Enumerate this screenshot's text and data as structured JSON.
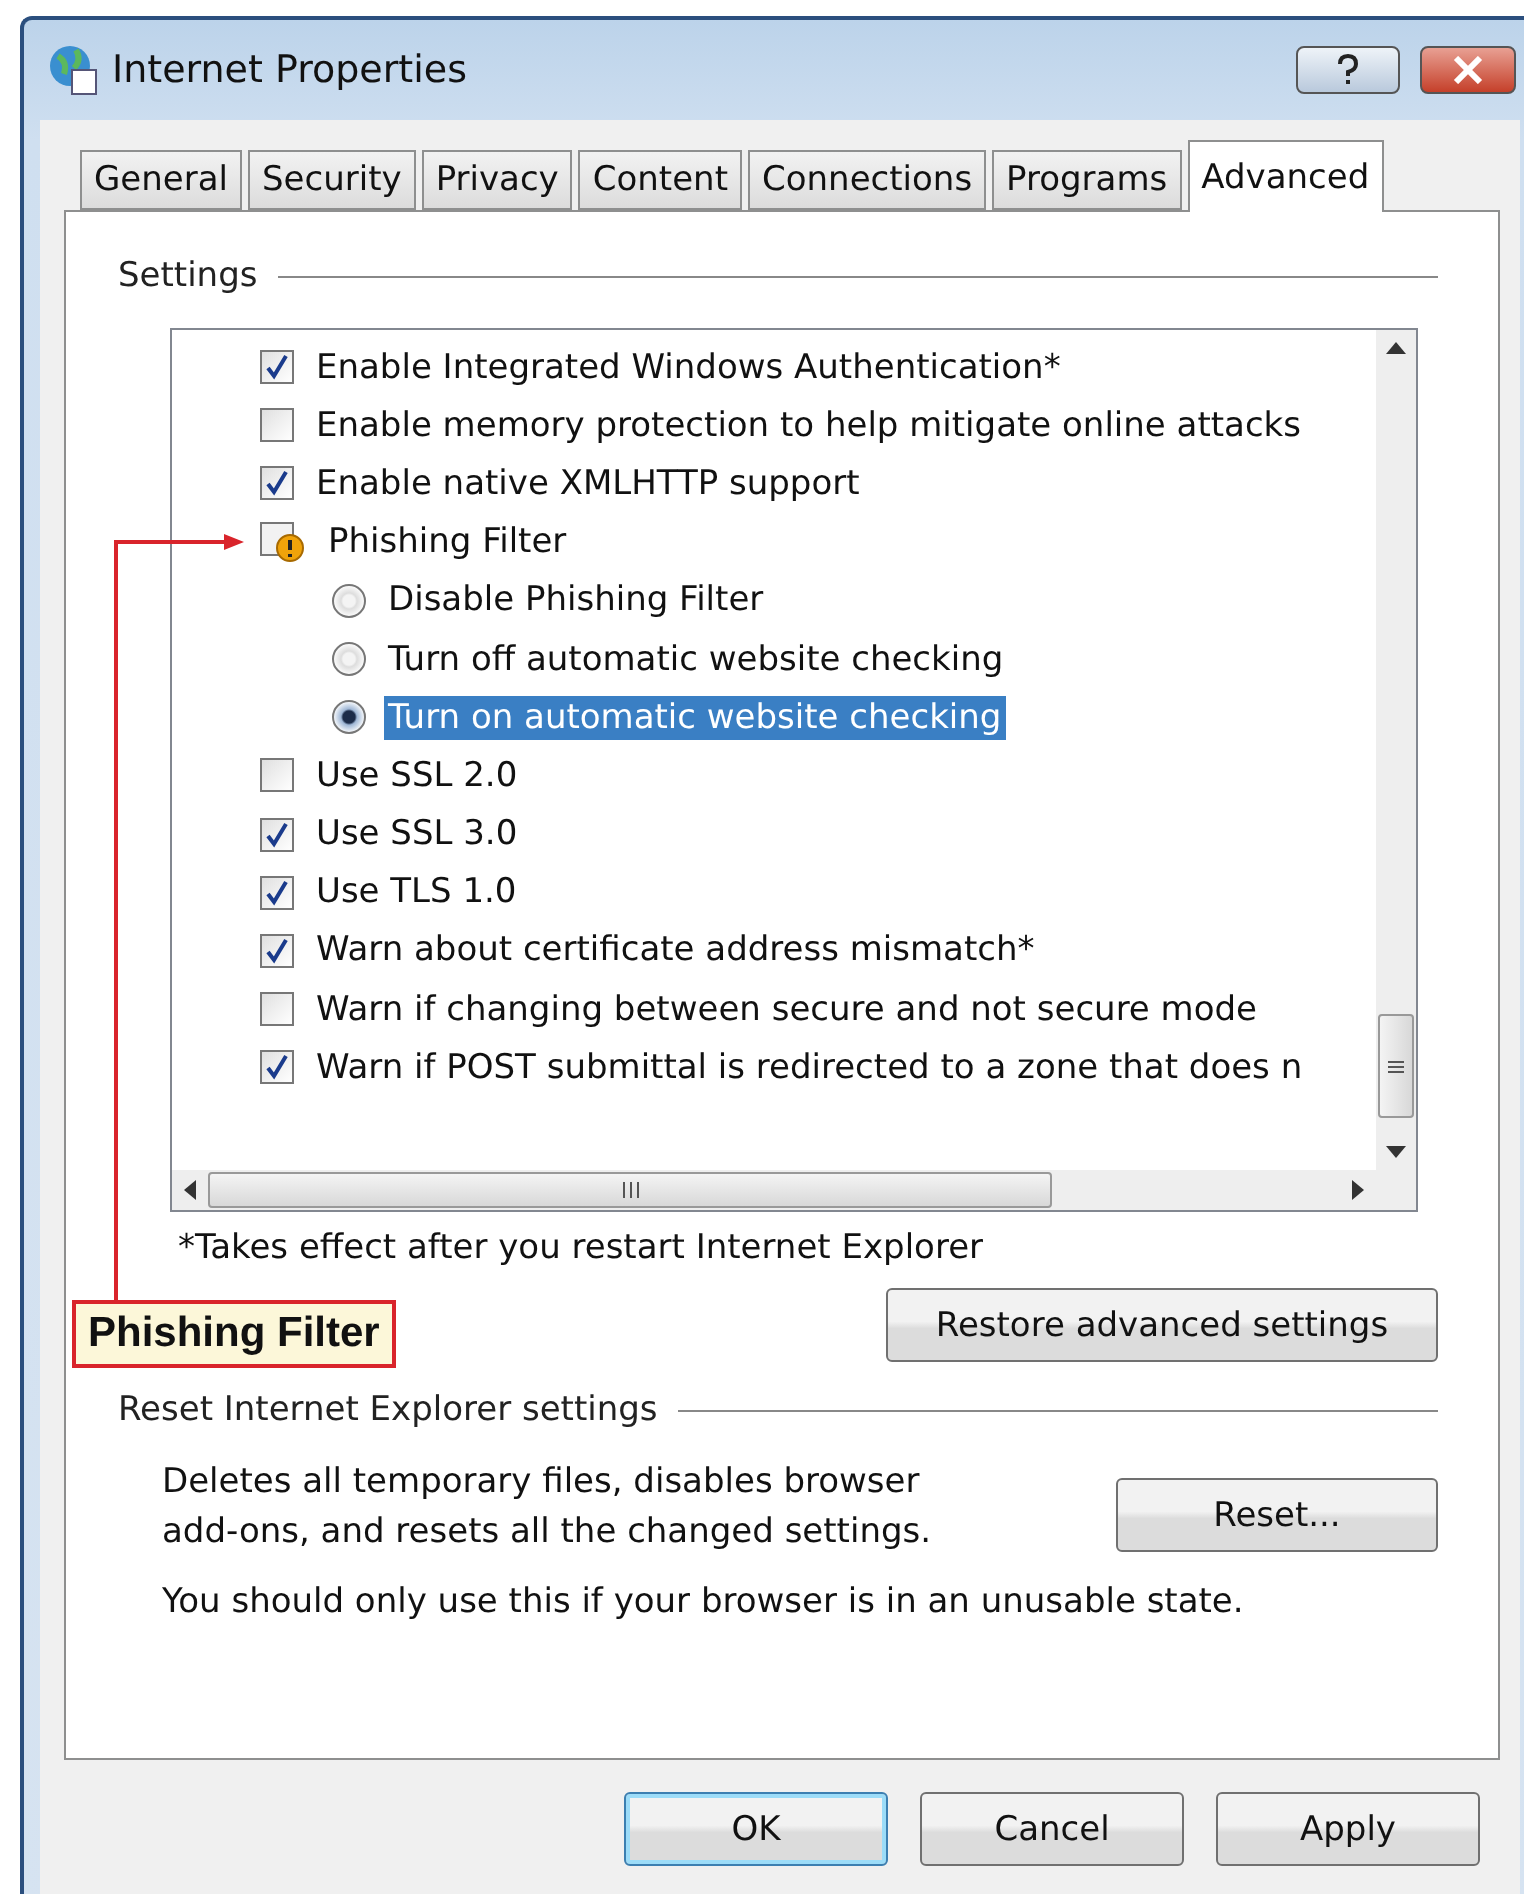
{
  "window": {
    "title": "Internet Properties"
  },
  "tabs": [
    {
      "label": "General",
      "selected": false
    },
    {
      "label": "Security",
      "selected": false
    },
    {
      "label": "Privacy",
      "selected": false
    },
    {
      "label": "Content",
      "selected": false
    },
    {
      "label": "Connections",
      "selected": false
    },
    {
      "label": "Programs",
      "selected": false
    },
    {
      "label": "Advanced",
      "selected": true
    }
  ],
  "settings": {
    "title": "Settings",
    "items": [
      {
        "kind": "checkbox",
        "label": "Enable Integrated Windows Authentication*",
        "checked": true
      },
      {
        "kind": "checkbox",
        "label": "Enable memory protection to help mitigate online attacks",
        "checked": false
      },
      {
        "kind": "checkbox",
        "label": "Enable native XMLHTTP support",
        "checked": true
      },
      {
        "kind": "group",
        "label": "Phishing Filter"
      },
      {
        "kind": "radio",
        "label": "Disable Phishing Filter",
        "selected": false
      },
      {
        "kind": "radio",
        "label": "Turn off automatic website checking",
        "selected": false
      },
      {
        "kind": "radio",
        "label": "Turn on automatic website checking",
        "selected": true
      },
      {
        "kind": "checkbox",
        "label": "Use SSL 2.0",
        "checked": false
      },
      {
        "kind": "checkbox",
        "label": "Use SSL 3.0",
        "checked": true
      },
      {
        "kind": "checkbox",
        "label": "Use TLS 1.0",
        "checked": true
      },
      {
        "kind": "checkbox",
        "label": "Warn about certificate address mismatch*",
        "checked": true
      },
      {
        "kind": "checkbox",
        "label": "Warn if changing between secure and not secure mode",
        "checked": false
      },
      {
        "kind": "checkbox",
        "label": "Warn if POST submittal is redirected to a zone that does n",
        "checked": true
      }
    ],
    "footnote": "*Takes effect after you restart Internet Explorer",
    "restore_button": "Restore advanced settings"
  },
  "callout": "Phishing Filter",
  "reset": {
    "title": "Reset Internet Explorer settings",
    "description": "Deletes all temporary files, disables browser add-ons, and resets all the changed settings.",
    "button": "Reset...",
    "warning": "You should only use this if your browser is in an unusable state."
  },
  "buttons": [
    "OK",
    "Cancel",
    "Apply"
  ]
}
